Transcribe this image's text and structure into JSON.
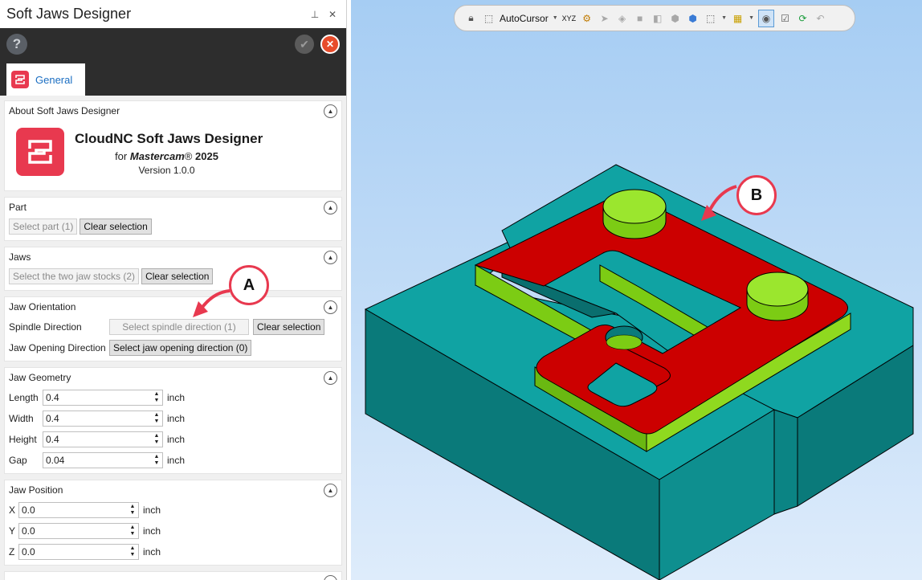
{
  "panel": {
    "title": "Soft Jaws Designer",
    "tab_label": "General"
  },
  "about": {
    "heading": "About Soft Jaws Designer",
    "product_name": "CloudNC Soft Jaws Designer",
    "for_prefix": "for",
    "host_app": "Mastercam",
    "registered": "®",
    "year": "2025",
    "version": "Version 1.0.0"
  },
  "part": {
    "heading": "Part",
    "select_button": "Select part (1)",
    "clear_button": "Clear selection"
  },
  "jaws": {
    "heading": "Jaws",
    "select_button": "Select the two jaw stocks (2)",
    "clear_button": "Clear selection"
  },
  "orientation": {
    "heading": "Jaw Orientation",
    "spindle_label": "Spindle Direction",
    "spindle_button": "Select spindle direction (1)",
    "spindle_clear": "Clear selection",
    "opening_label": "Jaw Opening Direction",
    "opening_button": "Select jaw opening direction (0)"
  },
  "geometry": {
    "heading": "Jaw Geometry",
    "fields": [
      {
        "label": "Length",
        "value": "0.4",
        "unit": "inch"
      },
      {
        "label": "Width",
        "value": "0.4",
        "unit": "inch"
      },
      {
        "label": "Height",
        "value": "0.4",
        "unit": "inch"
      },
      {
        "label": "Gap",
        "value": "0.04",
        "unit": "inch"
      }
    ]
  },
  "position": {
    "heading": "Jaw Position",
    "fields": [
      {
        "label": "X",
        "value": "0.0",
        "unit": "inch"
      },
      {
        "label": "Y",
        "value": "0.0",
        "unit": "inch"
      },
      {
        "label": "Z",
        "value": "0.0",
        "unit": "inch"
      }
    ]
  },
  "toolbar": {
    "autocursor_label": "AutoCursor",
    "xyz_label": "XYZ"
  },
  "callouts": {
    "a": "A",
    "b": "B"
  },
  "colors": {
    "accent": "#e8394f",
    "jaw_top": "#10a3a3",
    "jaw_side": "#0a7a7a",
    "part_top": "#cc0000",
    "part_wall": "#7ccc14",
    "boss": "#9be62e"
  }
}
